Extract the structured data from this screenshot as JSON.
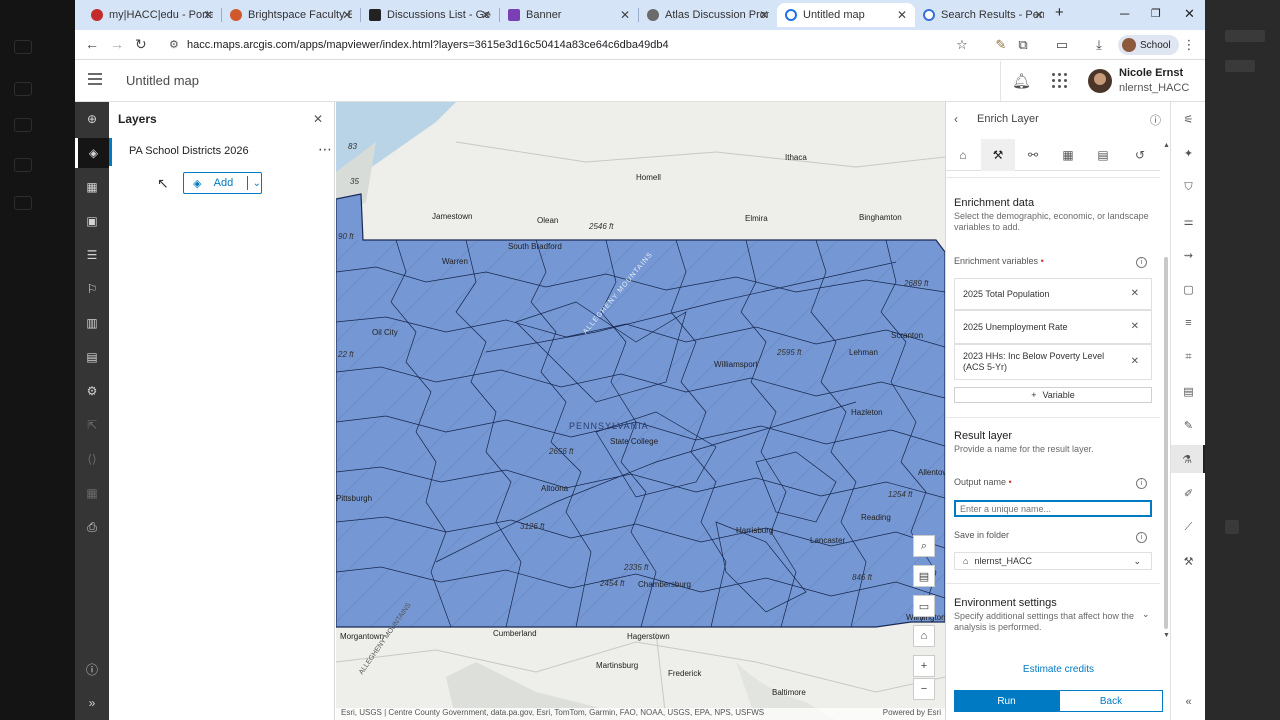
{
  "browser": {
    "tabs": [
      {
        "label": "my|HACC|edu - Portal",
        "favicon_color": "#c42b2b",
        "active": false
      },
      {
        "label": "Brightspace Faculty Enr",
        "favicon_color": "#d1582a",
        "active": false
      },
      {
        "label": "Discussions List - GeoA",
        "favicon_color": "#222222",
        "active": false
      },
      {
        "label": "Banner",
        "favicon_color": "#7b3fb5",
        "active": false
      },
      {
        "label": "Atlas Discussion Promp",
        "favicon_color": "#6b6b6b",
        "active": false
      },
      {
        "label": "Untitled map",
        "favicon_color": "#1a73e8",
        "active": true
      },
      {
        "label": "Search Results - Penns",
        "favicon_color": "#3a6fd8",
        "active": false
      }
    ],
    "new_tab": "+",
    "url": "hacc.maps.arcgis.com/apps/mapviewer/index.html?layers=3615e3d16c50414a83ce64c6dba49db4",
    "profile_label": "School"
  },
  "app": {
    "map_title": "Untitled map",
    "user_name": "Nicole Ernst",
    "user_id": "nlernst_HACC"
  },
  "layers_panel": {
    "title": "Layers",
    "layer_name": "PA School Districts 2026",
    "add_label": "Add"
  },
  "map": {
    "attribution": "Esri, USGS | Centre County Government, data.pa.gov, Esri, TomTom, Garmin, FAO, NOAA, USGS, EPA, NPS, USFWS",
    "powered_by": "Powered by Esri",
    "region_color": "#7597d3",
    "labels": [
      {
        "name": "Ithaca",
        "kind": "place"
      },
      {
        "name": "Homell",
        "kind": "place"
      },
      {
        "name": "Jamestown",
        "kind": "place"
      },
      {
        "name": "Olean",
        "kind": "place"
      },
      {
        "name": "Elmira",
        "kind": "place"
      },
      {
        "name": "Binghamton",
        "kind": "place"
      },
      {
        "name": "2546 ft",
        "kind": "elev"
      },
      {
        "name": "South Bradford",
        "kind": "place"
      },
      {
        "name": "Warren",
        "kind": "place"
      },
      {
        "name": "Oil City",
        "kind": "place"
      },
      {
        "name": "Williamsport",
        "kind": "place"
      },
      {
        "name": "2595 ft",
        "kind": "elev"
      },
      {
        "name": "Scranton",
        "kind": "place"
      },
      {
        "name": "Lehman",
        "kind": "place"
      },
      {
        "name": "2689 ft",
        "kind": "elev"
      },
      {
        "name": "PENNSYLVANIA",
        "kind": "region"
      },
      {
        "name": "State College",
        "kind": "place"
      },
      {
        "name": "Hazleton",
        "kind": "place"
      },
      {
        "name": "2656 ft",
        "kind": "elev"
      },
      {
        "name": "Altoona",
        "kind": "place"
      },
      {
        "name": "Pittsburgh",
        "kind": "place"
      },
      {
        "name": "Allentown",
        "kind": "place"
      },
      {
        "name": "1254 ft",
        "kind": "elev"
      },
      {
        "name": "Harrisburg",
        "kind": "place"
      },
      {
        "name": "Reading",
        "kind": "place"
      },
      {
        "name": "3126 ft",
        "kind": "elev"
      },
      {
        "name": "2335 ft",
        "kind": "elev"
      },
      {
        "name": "Lancaster",
        "kind": "place"
      },
      {
        "name": "846 ft",
        "kind": "elev"
      },
      {
        "name": "2454 ft",
        "kind": "elev"
      },
      {
        "name": "Chambersburg",
        "kind": "place"
      },
      {
        "name": "Morgantown",
        "kind": "place"
      },
      {
        "name": "Cumberland",
        "kind": "place"
      },
      {
        "name": "Hagerstown",
        "kind": "place"
      },
      {
        "name": "Wilmington",
        "kind": "place"
      },
      {
        "name": "Martinsburg",
        "kind": "place"
      },
      {
        "name": "Frederick",
        "kind": "place"
      },
      {
        "name": "Baltimore",
        "kind": "place"
      },
      {
        "name": "ALLEGHENY MOUNTAINS",
        "kind": "range"
      },
      {
        "name": "ALLEGHENY MOUNTAINS",
        "kind": "range"
      },
      {
        "name": "90 ft",
        "kind": "elev"
      },
      {
        "name": "22 ft",
        "kind": "elev"
      },
      {
        "name": "83",
        "kind": "elev"
      },
      {
        "name": "35",
        "kind": "elev"
      }
    ]
  },
  "enrich": {
    "title": "Enrich Layer",
    "enrichment_data_title": "Enrichment data",
    "enrichment_data_desc": "Select the demographic, economic, or landscape variables to add.",
    "variables_label": "Enrichment variables",
    "required_mark": "•",
    "variables": [
      "2025 Total Population",
      "2025 Unemployment Rate",
      "2023 HHs: Inc Below Poverty Level (ACS 5-Yr)"
    ],
    "add_variable": "Variable",
    "result_title": "Result layer",
    "result_desc": "Provide a name for the result layer.",
    "output_label": "Output name",
    "output_placeholder": "Enter a unique name...",
    "folder_label": "Save in folder",
    "folder_value": "nlernst_HACC",
    "env_title": "Environment settings",
    "env_desc": "Specify additional settings that affect how the analysis is performed.",
    "estimate": "Estimate credits",
    "run": "Run",
    "back": "Back"
  }
}
